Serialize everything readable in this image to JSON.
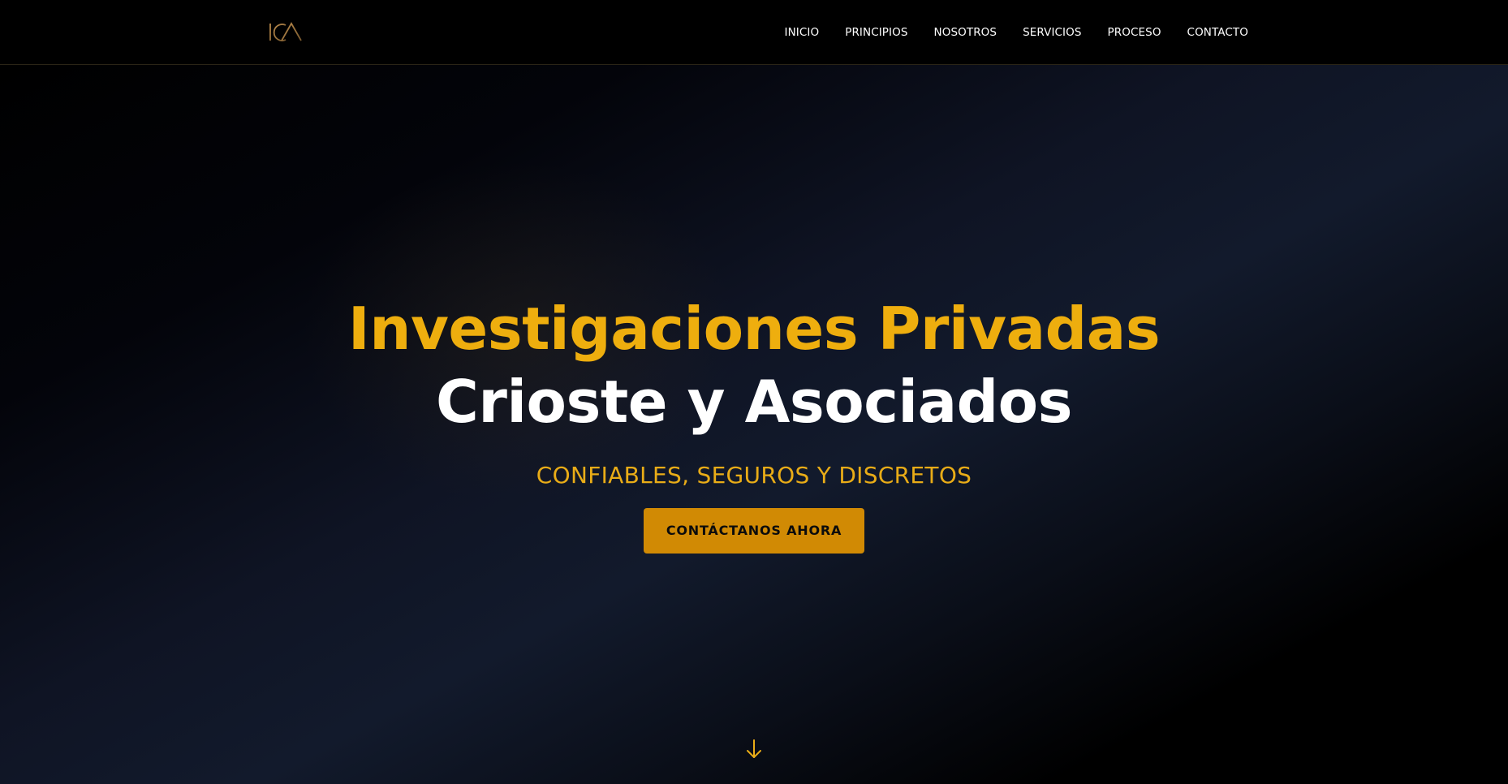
{
  "brand": {
    "logo_text": "ICA",
    "accent_color": "#eeae0e",
    "button_color": "#d18a04"
  },
  "nav": {
    "items": [
      {
        "label": "INICIO"
      },
      {
        "label": "PRINCIPIOS"
      },
      {
        "label": "NOSOTROS"
      },
      {
        "label": "SERVICIOS"
      },
      {
        "label": "PROCESO"
      },
      {
        "label": "CONTACTO"
      }
    ]
  },
  "hero": {
    "title_line1": "Investigaciones Privadas",
    "title_line2": "Crioste y Asociados",
    "tagline": "CONFIABLES, SEGUROS Y DISCRETOS",
    "cta_label": "CONTÁCTANOS AHORA",
    "scroll_icon": "arrow-down-icon"
  }
}
